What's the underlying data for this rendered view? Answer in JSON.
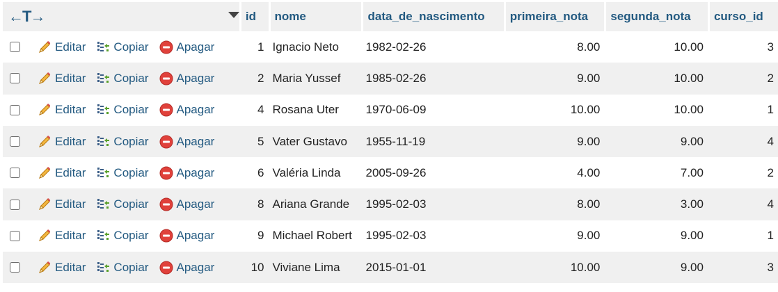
{
  "header": {
    "columns": {
      "id": "id",
      "nome": "nome",
      "data_de_nascimento": "data_de_nascimento",
      "primeira_nota": "primeira_nota",
      "segunda_nota": "segunda_nota",
      "curso_id": "curso_id"
    }
  },
  "actions": {
    "edit_label": "Editar",
    "copy_label": "Copiar",
    "delete_label": "Apagar"
  },
  "rows": [
    {
      "id": "1",
      "nome": "Ignacio Neto",
      "data": "1982-02-26",
      "pn": "8.00",
      "sn": "10.00",
      "curso": "3"
    },
    {
      "id": "2",
      "nome": "Maria Yussef",
      "data": "1985-02-26",
      "pn": "9.00",
      "sn": "10.00",
      "curso": "2"
    },
    {
      "id": "4",
      "nome": "Rosana Uter",
      "data": "1970-06-09",
      "pn": "10.00",
      "sn": "10.00",
      "curso": "1"
    },
    {
      "id": "5",
      "nome": "Vater Gustavo",
      "data": "1955-11-19",
      "pn": "9.00",
      "sn": "9.00",
      "curso": "4"
    },
    {
      "id": "6",
      "nome": "Valéria Linda",
      "data": "2005-09-26",
      "pn": "4.00",
      "sn": "7.00",
      "curso": "2"
    },
    {
      "id": "8",
      "nome": "Ariana Grande",
      "data": "1995-02-03",
      "pn": "8.00",
      "sn": "3.00",
      "curso": "4"
    },
    {
      "id": "9",
      "nome": "Michael Robert",
      "data": "1995-02-03",
      "pn": "9.00",
      "sn": "9.00",
      "curso": "1"
    },
    {
      "id": "10",
      "nome": "Viviane Lima",
      "data": "2015-01-01",
      "pn": "10.00",
      "sn": "9.00",
      "curso": "3"
    }
  ],
  "colors": {
    "link": "#235a81",
    "header_bg": "#f0f0f0",
    "delete_icon": "#e0413b",
    "pencil": "#f0a92c"
  }
}
